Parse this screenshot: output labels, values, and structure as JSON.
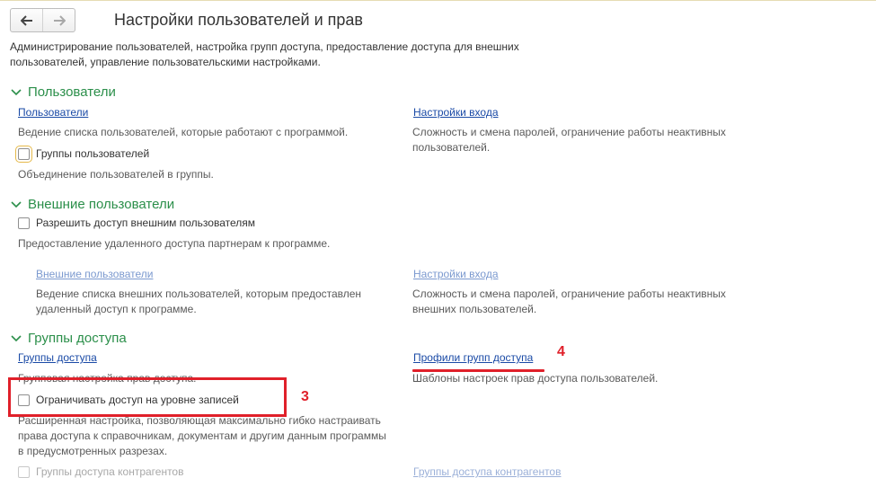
{
  "title": "Настройки пользователей и прав",
  "description": "Администрирование пользователей, настройка групп доступа, предоставление доступа для внешних пользователей, управление пользовательскими настройками.",
  "nav": {
    "back_icon": "arrow-left-icon",
    "forward_icon": "arrow-right-icon"
  },
  "sections": {
    "users": {
      "header": "Пользователи",
      "users_link": "Пользователи",
      "users_desc": "Ведение списка пользователей, которые работают с программой.",
      "login_link": "Настройки входа",
      "login_desc": "Сложность и смена паролей, ограничение работы неактивных пользователей.",
      "groups_check": "Группы пользователей",
      "groups_desc": "Объединение пользователей в группы."
    },
    "external": {
      "header": "Внешние пользователи",
      "allow_check": "Разрешить доступ внешним пользователям",
      "allow_desc": "Предоставление удаленного доступа партнерам к программе.",
      "ext_users_link": "Внешние пользователи",
      "ext_users_desc": "Ведение списка внешних пользователей, которым предоставлен удаленный доступ к программе.",
      "ext_login_link": "Настройки входа",
      "ext_login_desc": "Сложность и смена паролей, ограничение работы неактивных внешних пользователей."
    },
    "access": {
      "header": "Группы доступа",
      "groups_link": "Группы доступа",
      "groups_desc": "Групповая настройка прав доступа.",
      "profiles_link": "Профили групп доступа",
      "profiles_desc": "Шаблоны настроек прав доступа пользователей.",
      "restrict_check": "Ограничивать доступ на уровне записей",
      "restrict_desc": "Расширенная настройка, позволяющая максимально гибко настраивать права доступа к справочникам, документам и другим данным программы в предусмотренных разрезах.",
      "contractor_check": "Группы доступа контрагентов",
      "contractor_link": "Группы доступа контрагентов"
    }
  },
  "annotations": {
    "num3": "3",
    "num4": "4",
    "color": "#e0202a"
  },
  "colors": {
    "section_header": "#2b8f4a",
    "link": "#1a4aa6"
  }
}
